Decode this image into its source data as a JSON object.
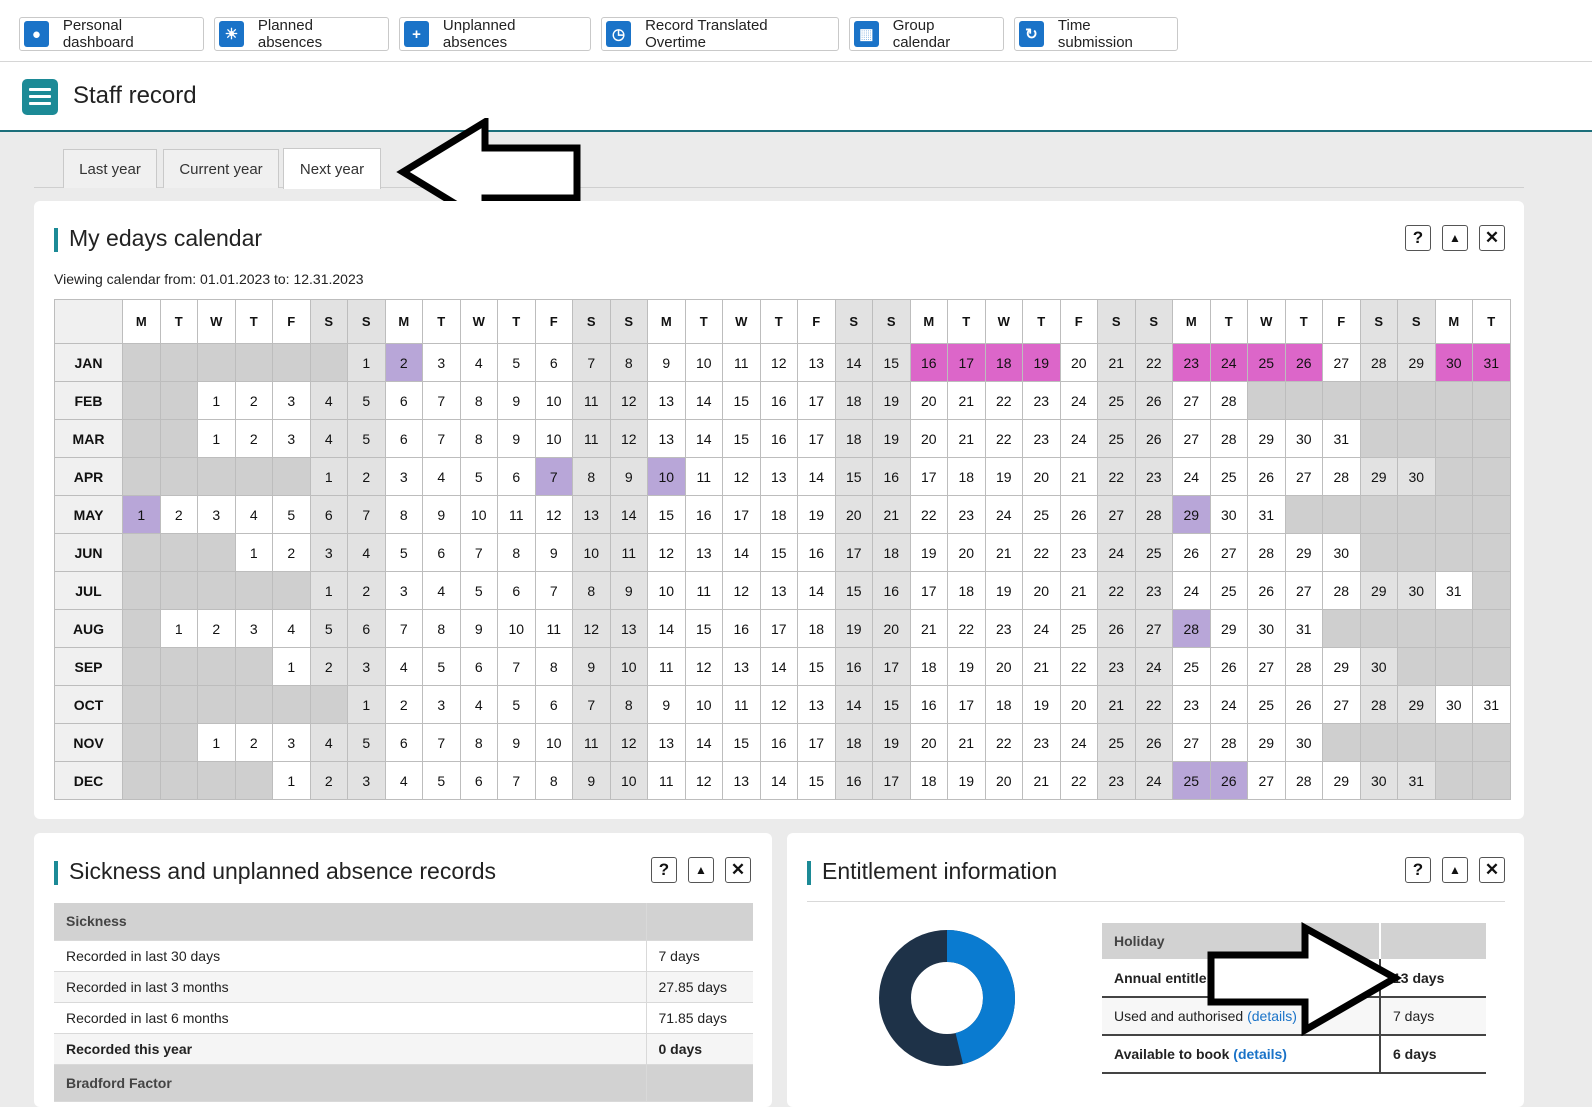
{
  "nav": [
    {
      "label": "Personal dashboard",
      "icon": "person-icon"
    },
    {
      "label": "Planned absences",
      "icon": "sun-icon"
    },
    {
      "label": "Unplanned absences",
      "icon": "plus-icon"
    },
    {
      "label": "Record Translated Overtime",
      "icon": "clock-icon"
    },
    {
      "label": "Group calendar",
      "icon": "calendar-icon"
    },
    {
      "label": "Time submission",
      "icon": "refresh-icon"
    }
  ],
  "header": {
    "title": "Staff record"
  },
  "tabs": [
    "Last year",
    "Current year",
    "Next year"
  ],
  "calendar_card": {
    "title": "My edays calendar",
    "viewing": "Viewing calendar from: 01.01.2023 to: 12.31.2023",
    "day_headers": [
      "M",
      "T",
      "W",
      "T",
      "F",
      "S",
      "S",
      "M",
      "T",
      "W",
      "T",
      "F",
      "S",
      "S",
      "M",
      "T",
      "W",
      "T",
      "F",
      "S",
      "S",
      "M",
      "T",
      "W",
      "T",
      "F",
      "S",
      "S",
      "M",
      "T",
      "W",
      "T",
      "F",
      "S",
      "S",
      "M",
      "T"
    ],
    "months": [
      {
        "name": "JAN",
        "start": 6,
        "days": 31,
        "booked": [
          2
        ],
        "requested": [
          16,
          17,
          18,
          19,
          23,
          24,
          25,
          26,
          30,
          31
        ]
      },
      {
        "name": "FEB",
        "start": 2,
        "days": 28,
        "booked": [],
        "requested": []
      },
      {
        "name": "MAR",
        "start": 2,
        "days": 31,
        "booked": [],
        "requested": []
      },
      {
        "name": "APR",
        "start": 5,
        "days": 30,
        "booked": [
          7,
          10
        ],
        "requested": []
      },
      {
        "name": "MAY",
        "start": 0,
        "days": 31,
        "booked": [
          1,
          29
        ],
        "requested": []
      },
      {
        "name": "JUN",
        "start": 3,
        "days": 30,
        "booked": [],
        "requested": []
      },
      {
        "name": "JUL",
        "start": 5,
        "days": 31,
        "booked": [],
        "requested": []
      },
      {
        "name": "AUG",
        "start": 1,
        "days": 31,
        "booked": [
          28
        ],
        "requested": []
      },
      {
        "name": "SEP",
        "start": 4,
        "days": 30,
        "booked": [],
        "requested": []
      },
      {
        "name": "OCT",
        "start": 6,
        "days": 31,
        "booked": [],
        "requested": []
      },
      {
        "name": "NOV",
        "start": 2,
        "days": 30,
        "booked": [],
        "requested": []
      },
      {
        "name": "DEC",
        "start": 4,
        "days": 31,
        "booked": [
          25,
          26
        ],
        "requested": []
      }
    ]
  },
  "sickness_card": {
    "title": "Sickness and unplanned absence records",
    "section": "Sickness",
    "rows": [
      {
        "label": "Recorded in last 30 days",
        "value": "7 days"
      },
      {
        "label": "Recorded in last 3 months",
        "value": "27.85 days"
      },
      {
        "label": "Recorded in last 6 months",
        "value": "71.85 days"
      },
      {
        "label": "Recorded this year",
        "value": "0 days"
      }
    ],
    "next_section": "Bradford Factor"
  },
  "entitlement_card": {
    "title": "Entitlement information",
    "section": "Holiday",
    "details_link": "(details)",
    "rows": [
      {
        "label": "Annual entitlement",
        "value": "13 days"
      },
      {
        "label": "Used and authorised",
        "value": "7 days"
      },
      {
        "label": "Available to book",
        "value": "6 days"
      }
    ],
    "donut": {
      "used_fraction": 0.4615
    }
  },
  "controls": {
    "help": "?",
    "collapse": "▲",
    "close": "✕"
  },
  "colors": {
    "accent": "#1c8a96",
    "booked": "#b8a6d8",
    "requested": "#dc66c9",
    "donut_used": "#0a7bd0",
    "donut_available": "#1e3248"
  }
}
